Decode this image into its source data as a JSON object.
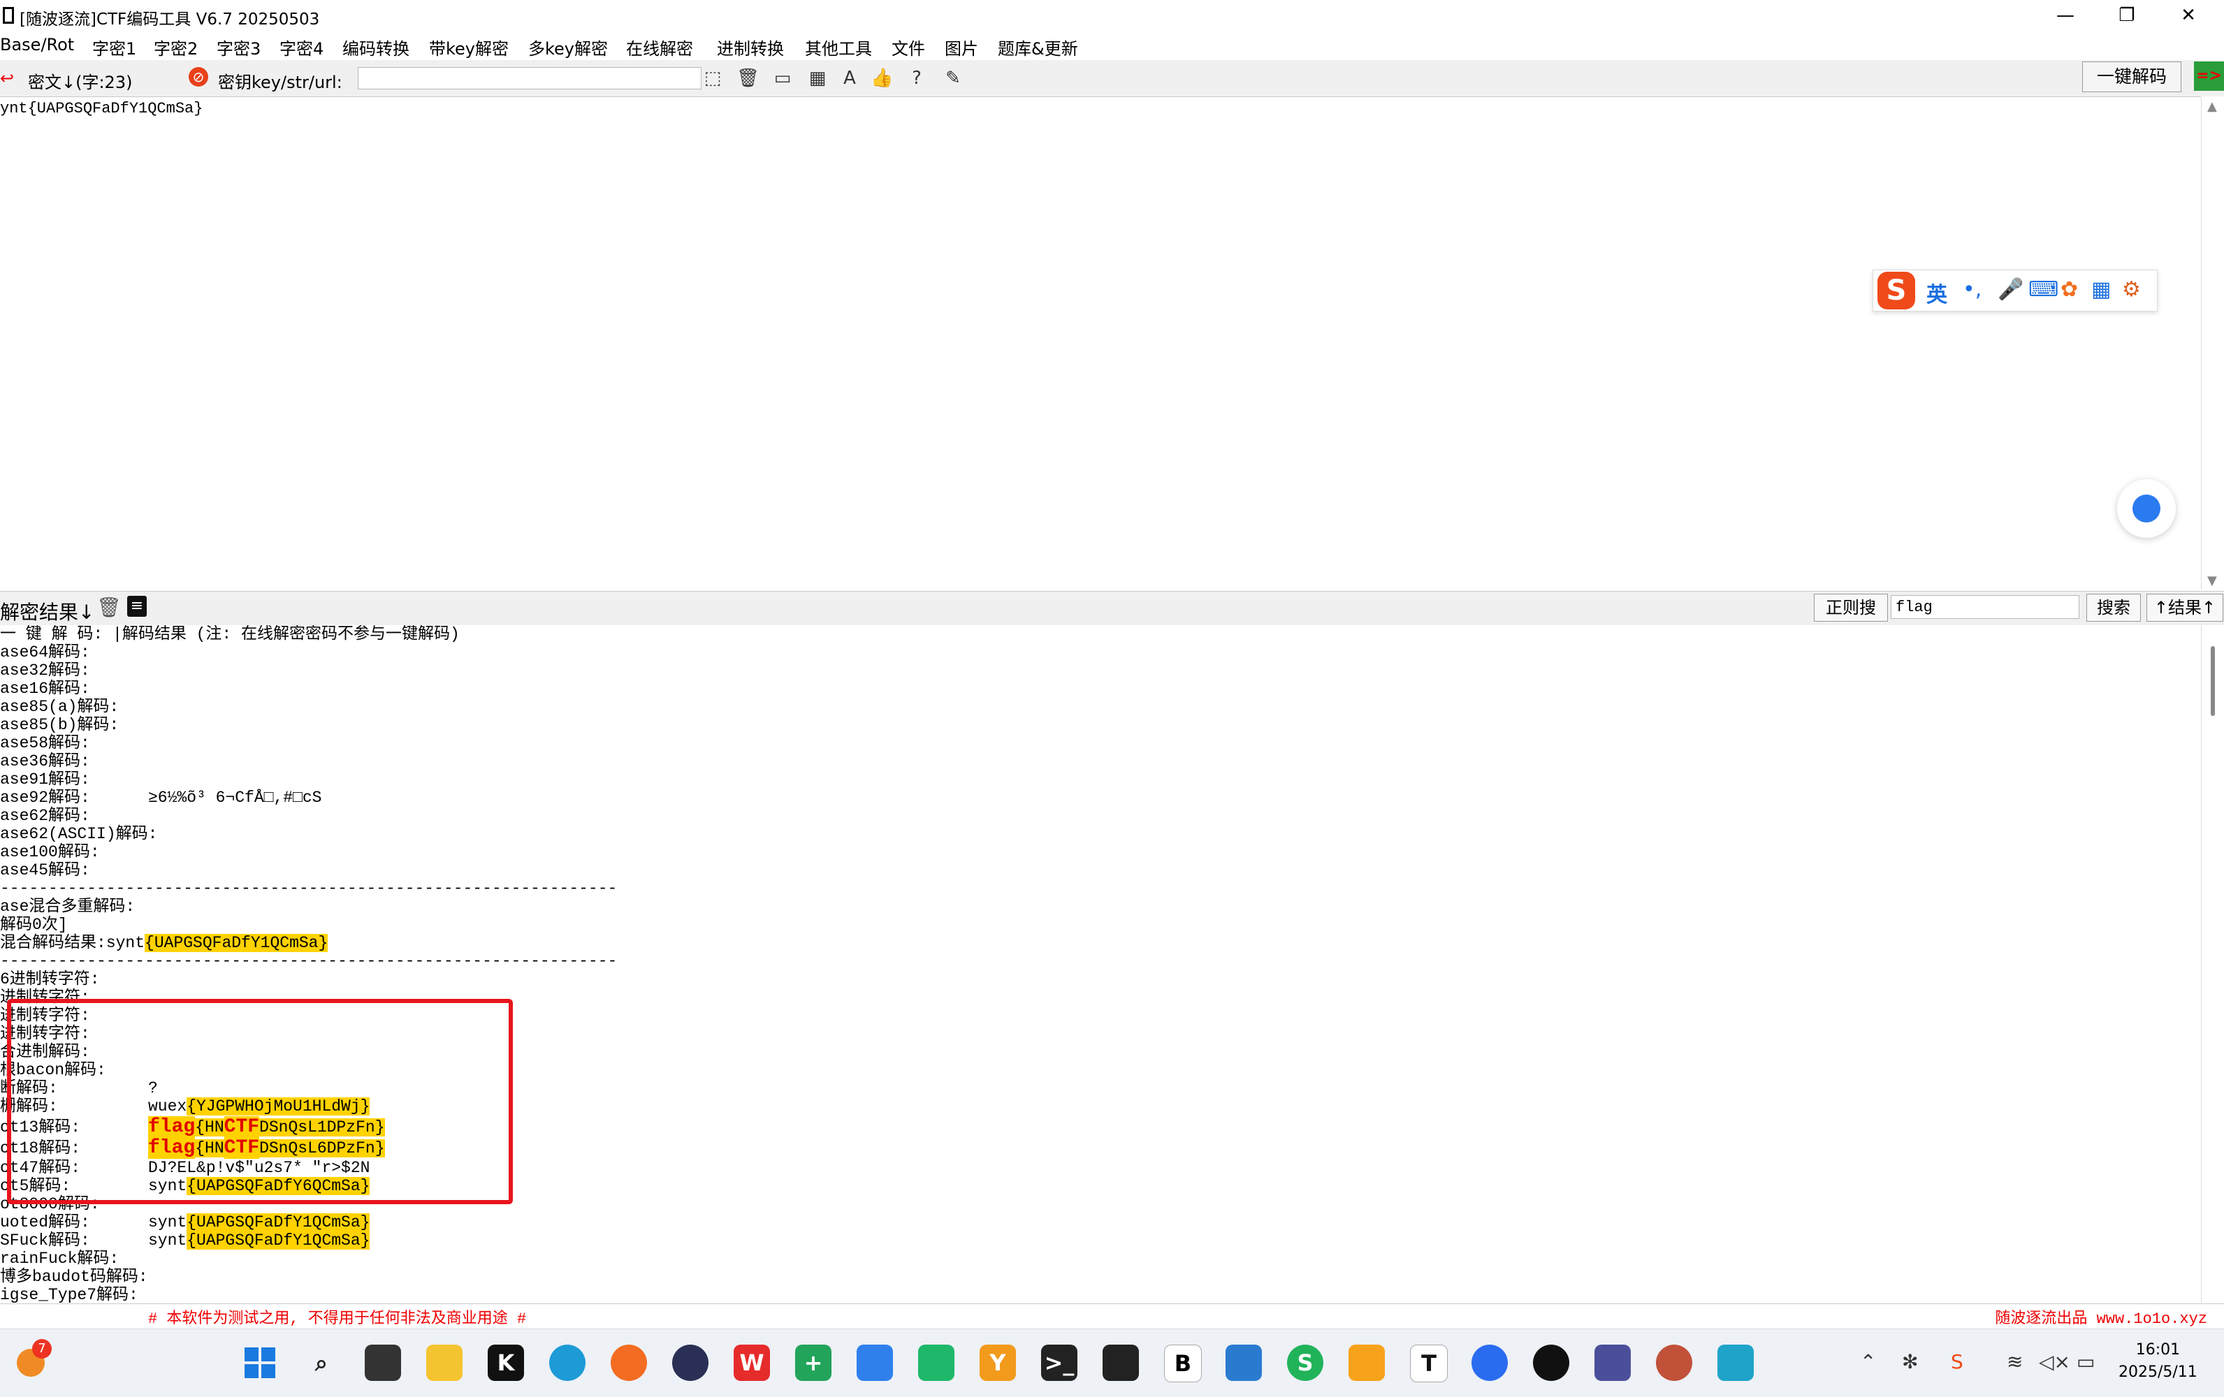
{
  "window": {
    "title": "[随波逐流]CTF编码工具 V6.7  20250503",
    "min": "—",
    "max": "❐",
    "close": "✕"
  },
  "menu": [
    "Base/Rot",
    "字密1",
    "字密2",
    "字密3",
    "字密4",
    "编码转换",
    "带key解密",
    "多key解密",
    "在线解密",
    "进制转换",
    "其他工具",
    "文件",
    "图片",
    "题库&更新"
  ],
  "keybar": {
    "cipher_label": "密文↓(字:23)",
    "key_label": "密钥key/str/url:",
    "key_value": "",
    "onekey_button": "一键解码",
    "arrow_label": "=>"
  },
  "input": {
    "text": "ynt{UAPGSQFaDfY1QCmSa}"
  },
  "ime": {
    "logo": "S",
    "lang": "英",
    "punct": "•,",
    "items": [
      "mic-icon",
      "keyboard-icon",
      "skin-icon",
      "apps-icon",
      "tool-icon"
    ]
  },
  "result_header": {
    "label": "解密结果↓",
    "regex_button": "正则搜",
    "search_value": "flag",
    "search_button": "搜索",
    "result_button": "↑结果↑"
  },
  "results": {
    "header": "一 键 解 码:     |解码结果 (注: 在线解密密码不参与一键解码)",
    "base_rows": [
      {
        "name": "ase64解码:",
        "value": ""
      },
      {
        "name": "ase32解码:",
        "value": ""
      },
      {
        "name": "ase16解码:",
        "value": ""
      },
      {
        "name": "ase85(a)解码:",
        "value": ""
      },
      {
        "name": "ase85(b)解码:",
        "value": ""
      },
      {
        "name": "ase58解码:",
        "value": ""
      },
      {
        "name": "ase36解码:",
        "value": ""
      },
      {
        "name": "ase91解码:",
        "value": ""
      },
      {
        "name": "ase92解码:",
        "value": "≥6½%õ³ 6¬CfÅ□,#□cS"
      },
      {
        "name": "ase62解码:",
        "value": ""
      },
      {
        "name": "ase62(ASCII)解码:",
        "value": ""
      },
      {
        "name": "ase100解码:",
        "value": ""
      },
      {
        "name": "ase45解码:",
        "value": ""
      }
    ],
    "divider": "----------------------------------------------------------------",
    "mix_title": "ase混合多重解码:",
    "mix_count": "解码0次]",
    "mix_result_label": "混合解码结果:",
    "mix_result_prefix": "synt",
    "mix_result_highlight": "{UAPGSQFaDfY1QCmSa}",
    "hex_rows": [
      {
        "name": "6进制转字符:",
        "value": ""
      },
      {
        "name": "进制转字符:",
        "value": ""
      },
      {
        "name": "进制转字符:",
        "value": ""
      },
      {
        "name": "进制转字符:",
        "value": ""
      },
      {
        "name": "合进制解码:",
        "value": ""
      },
      {
        "name": "根bacon解码:",
        "value": ""
      },
      {
        "name": "断解码:",
        "value": "?"
      }
    ],
    "fence_name": "栅解码:",
    "fence_prefix": "wuex",
    "fence_highlight": "{YJGPWHOjMoU1HLdWj}",
    "rot13_name": "ot13解码:",
    "rot13_flag": "flag",
    "rot13_a": "{HN",
    "rot13_ctf": "CTF",
    "rot13_b": "DSnQsL1DPzFn}",
    "rot18_name": "ot18解码:",
    "rot18_flag": "flag",
    "rot18_a": "{HN",
    "rot18_ctf": "CTF",
    "rot18_b": "DSnQsL6DPzFn}",
    "rot47_name": "ot47解码:",
    "rot47_value": "DJ?EL&p!v$\"u2s7* \"r>$2N",
    "rot5_name": "ot5解码:",
    "rot5_prefix": "synt",
    "rot5_highlight": "{UAPGSQFaDfY6QCmSa}",
    "rot8000_name": "ot8000解码:",
    "quoted_name": "uoted解码:",
    "quoted_prefix": "synt",
    "quoted_highlight": "{UAPGSQFaDfY1QCmSa}",
    "jsfuck_name": "SFuck解码:",
    "jsfuck_prefix": "synt",
    "jsfuck_highlight": "{UAPGSQFaDfY1QCmSa}",
    "brainfuck_name": "rainFuck解码:",
    "baudot_name": "博多baudot码解码:",
    "last_name": "igse_Type7解码:"
  },
  "status": {
    "left": "# 本软件为测试之用, 不得用于任何非法及商业用途 #",
    "right": "随波逐流出品 www.1o1o.xyz"
  },
  "taskbar": {
    "badge": "7",
    "time": "16:01",
    "date": "2025/5/11"
  },
  "colors": {
    "highlight": "#ffd200",
    "flag_text": "#e00000",
    "red_box": "#e8141c"
  }
}
